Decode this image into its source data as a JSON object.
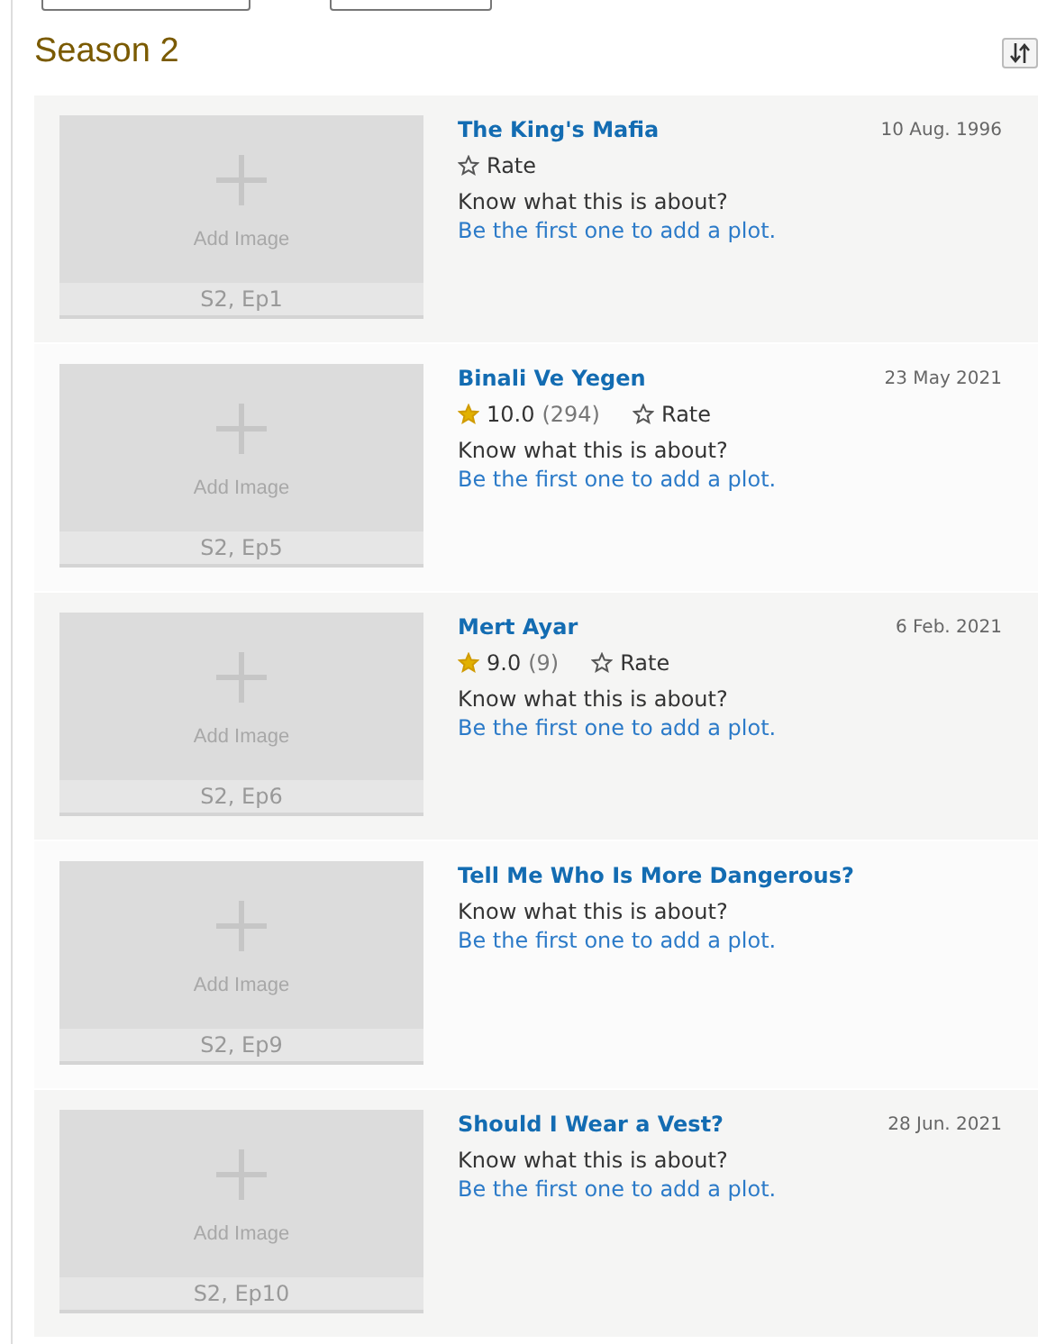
{
  "season": {
    "title": "Season 2"
  },
  "episodes": [
    {
      "title": "The King's Mafia",
      "date": "10 Aug. 1996",
      "rate_label": "Rate",
      "question": "Know what this is about?",
      "plot_link": "Be the first one to add a plot.",
      "image_label": "Add Image",
      "episode_label": "S2, Ep1"
    },
    {
      "title": "Binali Ve Yegen",
      "date": "23 May 2021",
      "rating": "10.0",
      "votes": "(294)",
      "rate_label": "Rate",
      "question": "Know what this is about?",
      "plot_link": "Be the first one to add a plot.",
      "image_label": "Add Image",
      "episode_label": "S2, Ep5"
    },
    {
      "title": "Mert Ayar",
      "date": "6 Feb. 2021",
      "rating": "9.0",
      "votes": "(9)",
      "rate_label": "Rate",
      "question": "Know what this is about?",
      "plot_link": "Be the first one to add a plot.",
      "image_label": "Add Image",
      "episode_label": "S2, Ep6"
    },
    {
      "title": "Tell Me Who Is More Dangerous?",
      "question": "Know what this is about?",
      "plot_link": "Be the first one to add a plot.",
      "image_label": "Add Image",
      "episode_label": "S2, Ep9"
    },
    {
      "title": "Should I Wear a Vest?",
      "date": "28 Jun. 2021",
      "question": "Know what this is about?",
      "plot_link": "Be the first one to add a plot.",
      "image_label": "Add Image",
      "episode_label": "S2, Ep10"
    }
  ]
}
